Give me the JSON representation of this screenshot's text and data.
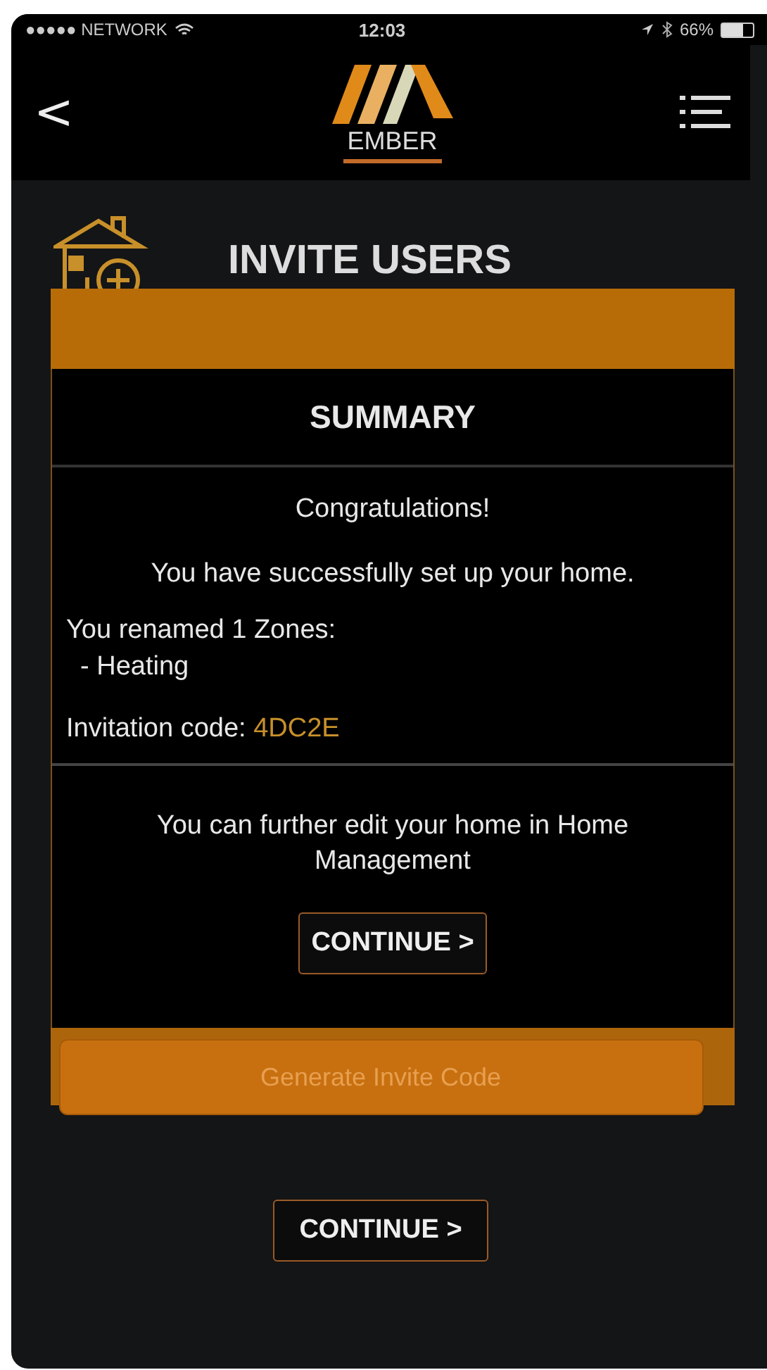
{
  "status_bar": {
    "carrier": "●●●●● NETWORK",
    "time": "12:03",
    "battery": "66%"
  },
  "nav": {
    "back": "<",
    "logo": "EMBER"
  },
  "page": {
    "title": "INVITE USERS",
    "generate_button": "Generate Invite Code",
    "continue_button": "CONTINUE >"
  },
  "dialog": {
    "title": "SUMMARY",
    "greeting": "Congratulations!",
    "message": "You have successfully set up your home.",
    "renamed": "You renamed 1 Zones:",
    "zones": [
      "- Heating"
    ],
    "code_label": "Invitation code:",
    "code": "4DC2E",
    "note": "You can further edit your home in Home Management",
    "continue_button": "CONTINUE >"
  }
}
